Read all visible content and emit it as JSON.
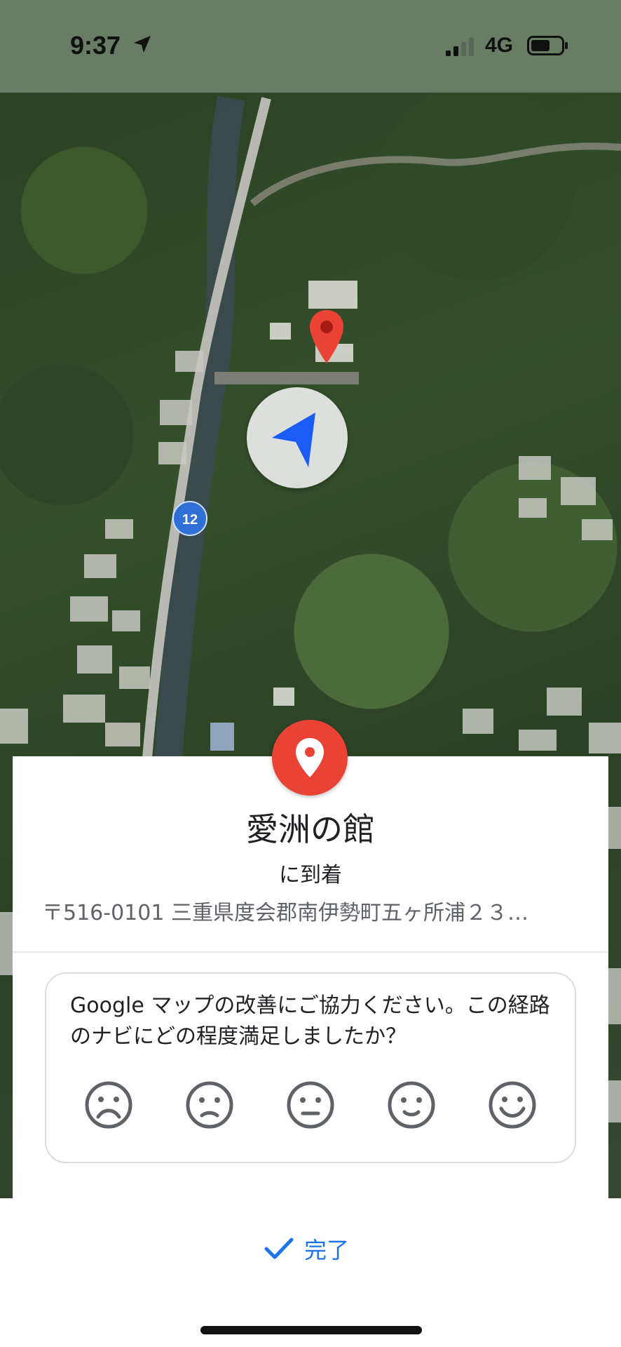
{
  "status_bar": {
    "time": "9:37",
    "network": "4G"
  },
  "map": {
    "route_number": "12",
    "icons": [
      "destination-pin-icon",
      "navigation-arrow-icon"
    ]
  },
  "arrival_card": {
    "place_name": "愛洲の館",
    "arrived_label": "に到着",
    "address": "〒516-0101 三重県度会郡南伊勢町五ヶ所浦２３…",
    "feedback_question": "Google マップの改善にご協力ください。この経路のナビにどの程度満足しましたか？",
    "rating_faces": [
      "very-dissatisfied",
      "dissatisfied",
      "neutral",
      "satisfied",
      "very-satisfied"
    ]
  },
  "bottom_sheet": {
    "done_label": "完了"
  },
  "colors": {
    "pin_red": "#ea4335",
    "nav_blue": "#1a5cf5",
    "link_blue": "#1a73e8"
  }
}
